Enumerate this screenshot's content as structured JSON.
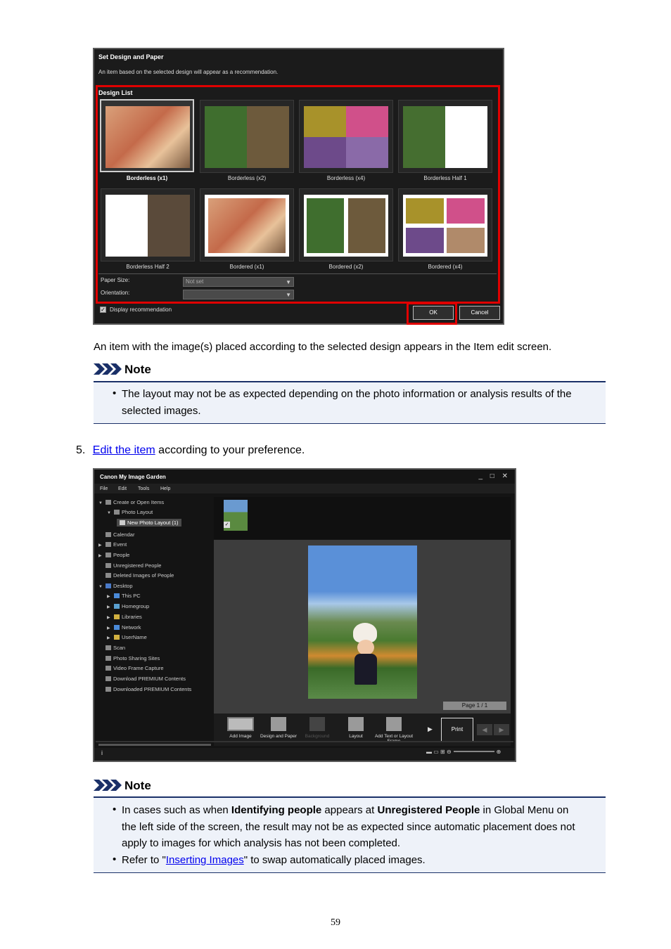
{
  "screenshot1": {
    "title": "Set Design and Paper",
    "subtitle": "An item based on the selected design will appear as a recommendation.",
    "section_label": "Design List",
    "designs": [
      {
        "label": "Borderless (x1)",
        "selected": true
      },
      {
        "label": "Borderless (x2)"
      },
      {
        "label": "Borderless (x4)"
      },
      {
        "label": "Borderless Half 1"
      },
      {
        "label": "Borderless Half 2"
      },
      {
        "label": "Bordered (x1)"
      },
      {
        "label": "Bordered (x2)"
      },
      {
        "label": "Bordered (x4)"
      }
    ],
    "paper_size_label": "Paper Size:",
    "paper_size_value": "Not set",
    "orientation_label": "Orientation:",
    "display_recommendation_label": "Display recommendation",
    "ok_label": "OK",
    "cancel_label": "Cancel"
  },
  "text1": "An item with the image(s) placed according to the selected design appears in the Item edit screen.",
  "note1": {
    "heading": "Note",
    "items": [
      "The layout may not be as expected depending on the photo information or analysis results of the selected images."
    ]
  },
  "step5": {
    "number": "5.",
    "link_text": "Edit the item",
    "rest": " according to your preference."
  },
  "screenshot2": {
    "title": "Canon My Image Garden",
    "window_buttons": "_ □ ✕",
    "menus": [
      "File",
      "Edit",
      "Tools",
      "Help"
    ],
    "tree": [
      "Create or Open Items",
      "Photo Layout",
      "New Photo Layout (1)",
      "Calendar",
      "Event",
      "People",
      "Unregistered People",
      "Deleted Images of People",
      "Desktop",
      "This PC",
      "Homegroup",
      "Libraries",
      "Network",
      "UserName",
      "Scan",
      "Photo Sharing Sites",
      "Video Frame Capture",
      "Download PREMIUM Contents",
      "Downloaded PREMIUM Contents"
    ],
    "page_indicator": "Page 1 / 1",
    "toolbar": [
      "Add Image",
      "Design and Paper",
      "Background",
      "Layout",
      "Add Text or Layout Frame"
    ],
    "print_label": "Print",
    "info_icon": "i"
  },
  "note2": {
    "heading": "Note",
    "item1_pre": "In cases such as when ",
    "item1_b1": "Identifying people",
    "item1_mid": " appears at ",
    "item1_b2": "Unregistered People",
    "item1_line1_end": " in Global Menu on",
    "item1_line2": "the left side of the screen, the result may not be as expected since automatic placement does not",
    "item1_line3": "apply to images for which analysis has not been completed.",
    "item2_pre": "Refer to \"",
    "item2_link": "Inserting Images",
    "item2_post": "\" to swap automatically placed images."
  },
  "page_number": "59",
  "colors": {
    "highlight_red": "#e00000",
    "note_border": "#1a3068",
    "note_bg": "#eef2f9",
    "link": "#0000ee"
  }
}
